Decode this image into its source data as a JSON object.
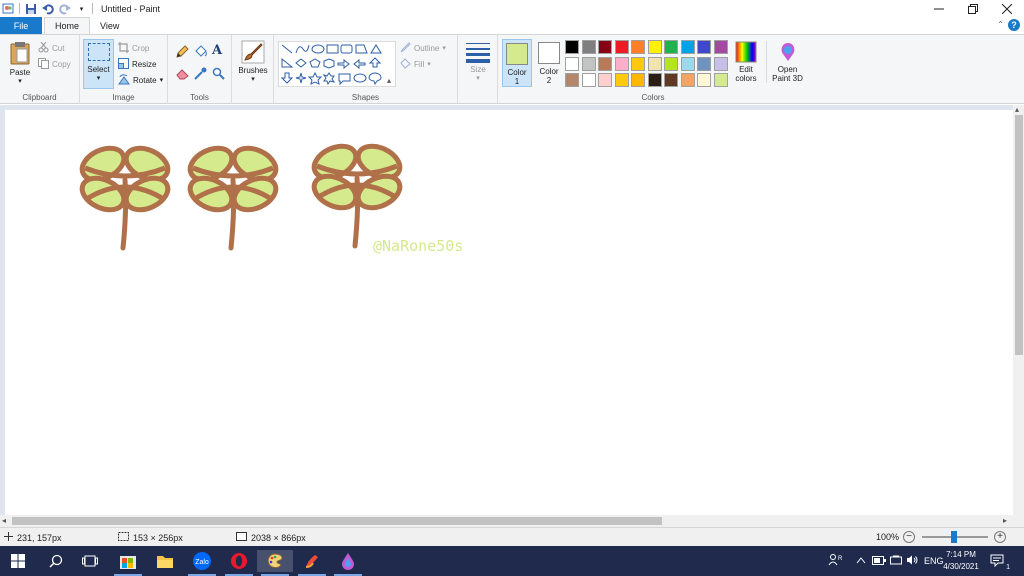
{
  "window": {
    "title": "Untitled - Paint"
  },
  "tabs": [
    {
      "label": "File"
    },
    {
      "label": "Home"
    },
    {
      "label": "View"
    }
  ],
  "clipboard": {
    "group_label": "Clipboard",
    "paste": "Paste",
    "cut": "Cut",
    "copy": "Copy"
  },
  "image": {
    "group_label": "Image",
    "select": "Select",
    "crop": "Crop",
    "resize": "Resize",
    "rotate": "Rotate"
  },
  "tools": {
    "group_label": "Tools"
  },
  "brushes": {
    "label": "Brushes"
  },
  "shapes": {
    "group_label": "Shapes",
    "outline": "Outline",
    "fill": "Fill"
  },
  "size": {
    "label": "Size"
  },
  "colors": {
    "group_label": "Colors",
    "color1_label": "Color",
    "color1_num": "1",
    "color1_value": "#d4ea8c",
    "color2_label": "Color",
    "color2_num": "2",
    "color2_value": "#ffffff",
    "edit_label1": "Edit",
    "edit_label2": "colors",
    "open3d_label1": "Open",
    "open3d_label2": "Paint 3D",
    "palette_row1": [
      "#000000",
      "#7f7f7f",
      "#880015",
      "#ed1c24",
      "#ff7f27",
      "#fff200",
      "#22b14c",
      "#00a2e8",
      "#3f48cc",
      "#a349a4"
    ],
    "palette_row2": [
      "#ffffff",
      "#c3c3c3",
      "#b97a57",
      "#ffaec9",
      "#ffc90e",
      "#efe4b0",
      "#b5e61d",
      "#99d9ea",
      "#7092be",
      "#c8bfe7"
    ],
    "palette_row3": [
      "#b5876a",
      "#ffffff",
      "#ffcfcf",
      "#ffc90e",
      "#ffb700",
      "#2b1d13",
      "#5e3a24",
      "#f4a460",
      "#fff6d5",
      "#d4ea8c"
    ]
  },
  "canvas": {
    "watermark": "@NaRone50s",
    "stroke_color": "#b07049",
    "fill_color": "#d4ea8c"
  },
  "status": {
    "cursor": "231, 157px",
    "selection": "153 × 256px",
    "image_size": "2038 × 866px",
    "zoom": "100%"
  },
  "taskbar": {
    "lang": "ENG",
    "time": "7:14 PM",
    "date": "4/30/2021",
    "notif_count": "1"
  }
}
